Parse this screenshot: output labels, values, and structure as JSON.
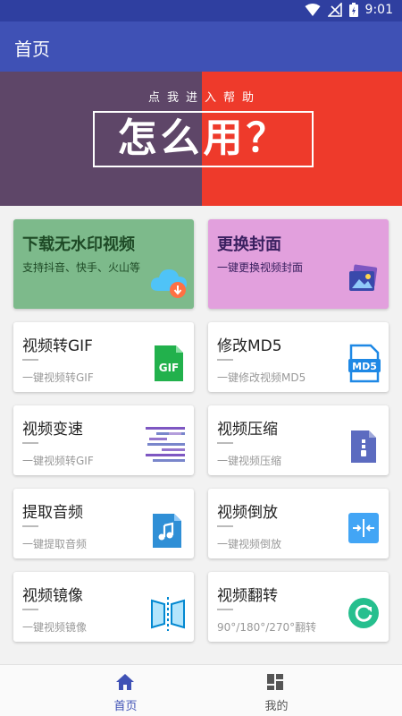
{
  "status": {
    "time": "9:01"
  },
  "appbar": {
    "title": "首页"
  },
  "banner": {
    "subtitle": "点我进入帮助",
    "headline": "怎么用？"
  },
  "colors": {
    "primary": "#3f51b5",
    "status_bar": "#2f3fa0",
    "banner_left": "#5e4668",
    "banner_right": "#ee3a2b",
    "card_green": "#7dba8b",
    "card_pink": "#e2a0dd",
    "tab_active": "#3f51b5",
    "tab_inactive": "#555555"
  },
  "featured": [
    {
      "title": "下载无水印视频",
      "subtitle": "支持抖音、快手、火山等",
      "icon": "cloud-download-icon"
    },
    {
      "title": "更换封面",
      "subtitle": "一键更换视频封面",
      "icon": "image-icon"
    }
  ],
  "tools": [
    {
      "title": "视频转GIF",
      "subtitle": "一键视频转GIF",
      "icon": "gif-file-icon"
    },
    {
      "title": "修改MD5",
      "subtitle": "一键修改视频MD5",
      "icon": "md5-file-icon"
    },
    {
      "title": "视频变速",
      "subtitle": "一键视频转GIF",
      "icon": "speed-icon"
    },
    {
      "title": "视频压缩",
      "subtitle": "一键视频压缩",
      "icon": "zip-file-icon"
    },
    {
      "title": "提取音频",
      "subtitle": "一键提取音频",
      "icon": "music-file-icon"
    },
    {
      "title": "视频倒放",
      "subtitle": "一键视频倒放",
      "icon": "reverse-icon"
    },
    {
      "title": "视频镜像",
      "subtitle": "一键视频镜像",
      "icon": "mirror-icon"
    },
    {
      "title": "视频翻转",
      "subtitle": "90°/180°/270°翻转",
      "icon": "rotate-icon"
    }
  ],
  "bottom_nav": [
    {
      "label": "首页",
      "icon": "home-icon",
      "active": true
    },
    {
      "label": "我的",
      "icon": "dashboard-icon",
      "active": false
    }
  ]
}
